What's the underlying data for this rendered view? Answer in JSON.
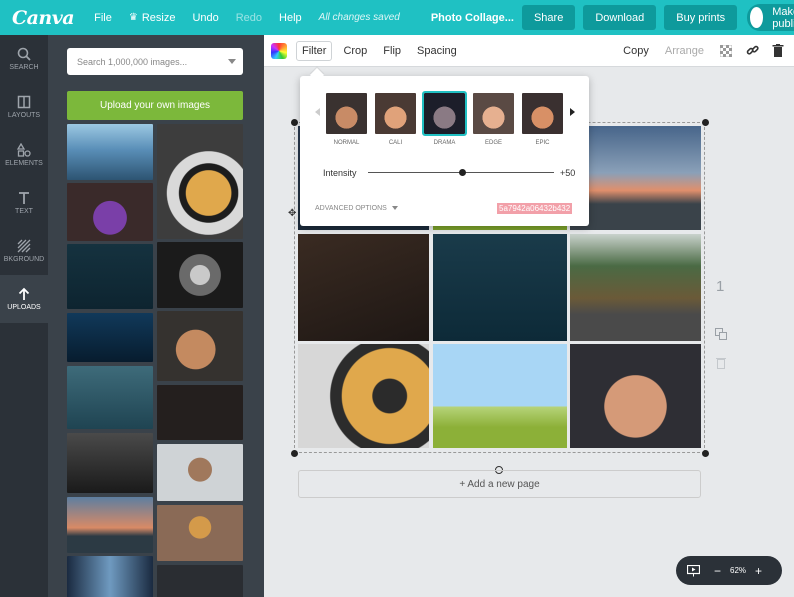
{
  "topbar": {
    "logo": "Canva",
    "file": "File",
    "resize": "Resize",
    "undo": "Undo",
    "redo": "Redo",
    "help": "Help",
    "status": "All changes saved",
    "doc_title": "Photo Collage...",
    "share": "Share",
    "download": "Download",
    "buy_prints": "Buy prints",
    "make_public": "Make public"
  },
  "sidebar": {
    "items": [
      {
        "label": "Search",
        "icon": "search-icon"
      },
      {
        "label": "Layouts",
        "icon": "layouts-icon"
      },
      {
        "label": "Elements",
        "icon": "elements-icon"
      },
      {
        "label": "Text",
        "icon": "text-icon"
      },
      {
        "label": "Bkground",
        "icon": "background-icon"
      },
      {
        "label": "Uploads",
        "icon": "upload-icon"
      }
    ]
  },
  "panel": {
    "search_placeholder": "Search 1,000,000 images...",
    "upload_button": "Upload your own images"
  },
  "toolbar": {
    "filter": "Filter",
    "crop": "Crop",
    "flip": "Flip",
    "spacing": "Spacing",
    "copy": "Copy",
    "arrange": "Arrange"
  },
  "filter_popup": {
    "filters": [
      "NORMAL",
      "CALI",
      "DRAMA",
      "EDGE",
      "EPIC"
    ],
    "selected": "DRAMA",
    "intensity_label": "Intensity",
    "intensity_value": "+50",
    "advanced_options": "ADVANCED OPTIONS",
    "hash": "5a7942a06432b432"
  },
  "canvas": {
    "add_page": "+ Add a new page",
    "page_number": "1"
  },
  "zoom": {
    "level": "62%",
    "minus": "−",
    "plus": "+"
  },
  "colors": {
    "brand_teal": "#1fc1c3",
    "sidebar_dark": "#2b3138",
    "upload_green": "#7cb83b"
  }
}
